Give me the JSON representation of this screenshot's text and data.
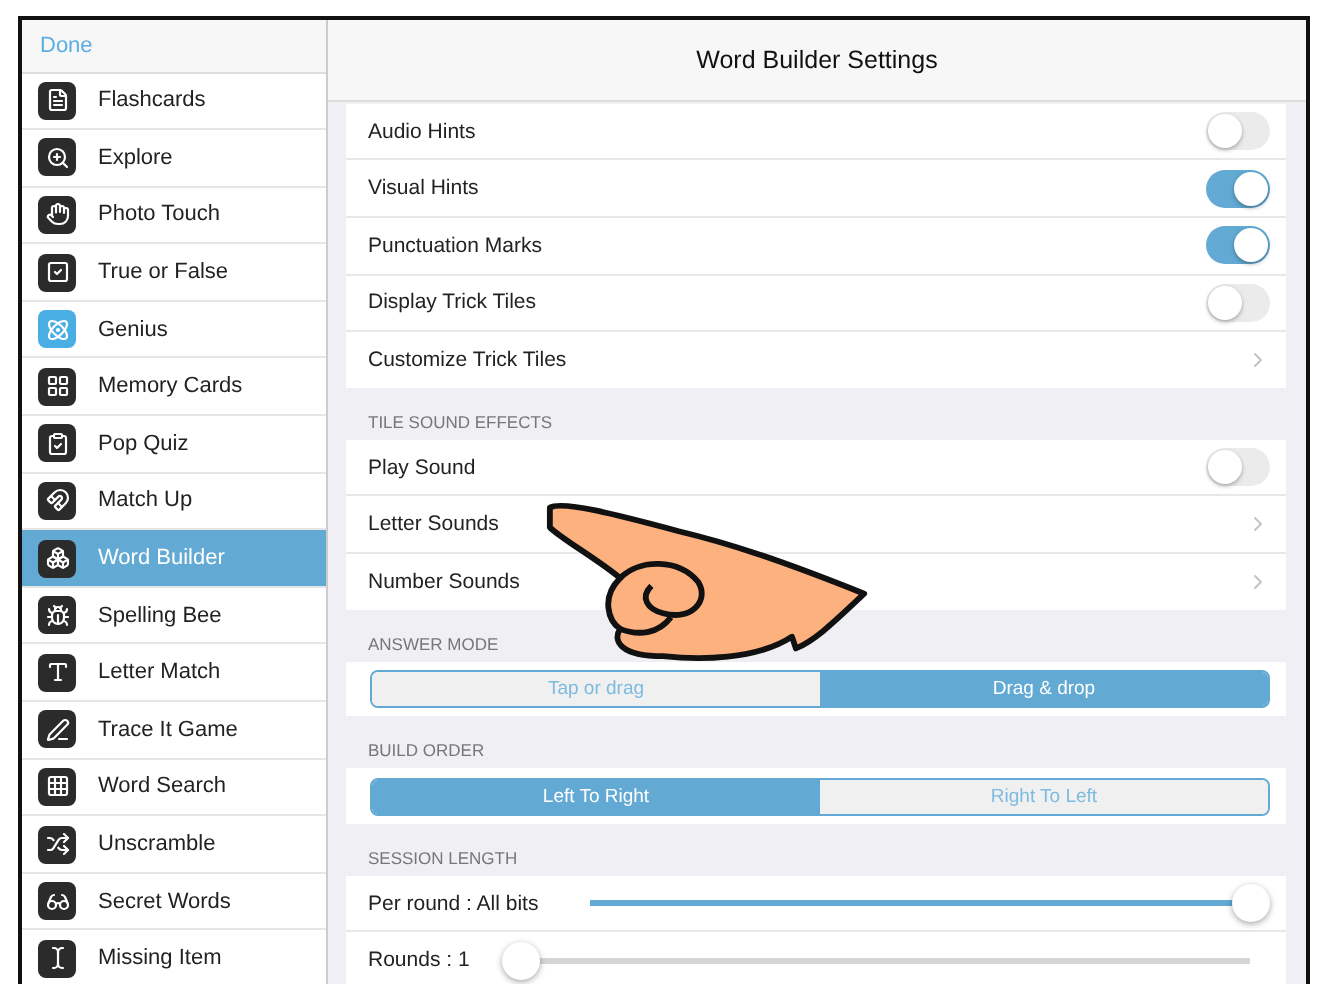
{
  "sidebar": {
    "done": "Done",
    "items": [
      {
        "label": "Flashcards",
        "selected": false
      },
      {
        "label": "Explore",
        "selected": false
      },
      {
        "label": "Photo Touch",
        "selected": false
      },
      {
        "label": "True or False",
        "selected": false
      },
      {
        "label": "Genius",
        "selected": false
      },
      {
        "label": "Memory Cards",
        "selected": false
      },
      {
        "label": "Pop Quiz",
        "selected": false
      },
      {
        "label": "Match Up",
        "selected": false
      },
      {
        "label": "Word Builder",
        "selected": true
      },
      {
        "label": "Spelling Bee",
        "selected": false
      },
      {
        "label": "Letter Match",
        "selected": false
      },
      {
        "label": "Trace It Game",
        "selected": false
      },
      {
        "label": "Word Search",
        "selected": false
      },
      {
        "label": "Unscramble",
        "selected": false
      },
      {
        "label": "Secret Words",
        "selected": false
      },
      {
        "label": "Missing Item",
        "selected": false
      }
    ]
  },
  "title": "Word Builder Settings",
  "sections": [
    {
      "rows": [
        {
          "kind": "toggle",
          "label": "Audio Hints",
          "on": false
        },
        {
          "kind": "toggle",
          "label": "Visual Hints",
          "on": true
        },
        {
          "kind": "toggle",
          "label": "Punctuation Marks",
          "on": true
        },
        {
          "kind": "toggle",
          "label": "Display Trick Tiles",
          "on": false
        },
        {
          "kind": "link",
          "label": "Customize Trick Tiles"
        }
      ]
    },
    {
      "header": "TILE SOUND EFFECTS",
      "rows": [
        {
          "kind": "toggle",
          "label": "Play Sound",
          "on": false
        },
        {
          "kind": "link",
          "label": "Letter Sounds"
        },
        {
          "kind": "link",
          "label": "Number Sounds"
        }
      ]
    },
    {
      "header": "ANSWER MODE",
      "rows": [
        {
          "kind": "segmented",
          "options": [
            {
              "label": "Tap or drag",
              "selected": false
            },
            {
              "label": "Drag & drop",
              "selected": true
            }
          ]
        }
      ]
    },
    {
      "header": "BUILD ORDER",
      "rows": [
        {
          "kind": "segmented",
          "options": [
            {
              "label": "Left To Right",
              "selected": true
            },
            {
              "label": "Right To Left",
              "selected": false
            }
          ]
        }
      ]
    },
    {
      "header": "SESSION LENGTH",
      "rows": [
        {
          "kind": "slider",
          "label": "Per round : All bits",
          "level": 1
        },
        {
          "kind": "slider",
          "label": "Rounds : 1",
          "level": 0
        }
      ]
    }
  ]
}
